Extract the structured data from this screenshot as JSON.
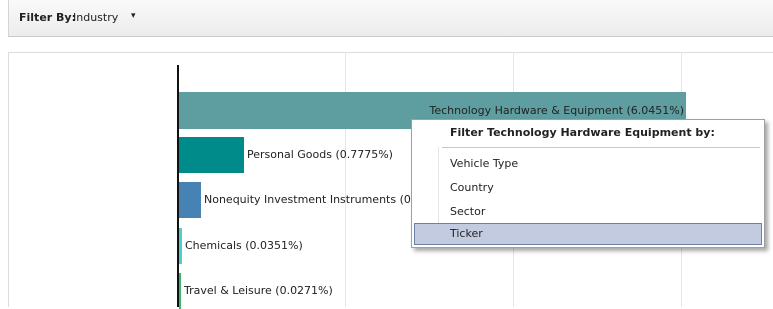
{
  "filter": {
    "label": "Filter By:",
    "value": "Industry",
    "caret": "▾"
  },
  "bars": [
    {
      "label": "Technology Hardware & Equipment (6.0451%)",
      "value": 6.0451,
      "color": "#5f9ea0"
    },
    {
      "label": "Personal Goods (0.7775%)",
      "value": 0.7775,
      "color": "#008b8b"
    },
    {
      "label": "Nonequity Investment Instruments (0",
      "value": 0.26,
      "color": "#4682b4"
    },
    {
      "label": "Chemicals (0.0351%)",
      "value": 0.0351,
      "color": "#48d1cc"
    },
    {
      "label": "Travel & Leisure (0.0271%)",
      "value": 0.0271,
      "color": "#3cb371"
    }
  ],
  "context_menu": {
    "title": "Filter Technology Hardware  Equipment by:",
    "items": [
      {
        "label": "Vehicle Type",
        "selected": false
      },
      {
        "label": "Country",
        "selected": false
      },
      {
        "label": "Sector",
        "selected": false
      },
      {
        "label": "Ticker",
        "selected": true
      }
    ]
  },
  "colors": {
    "selected_item_bg": "#c3cbe0",
    "axis": "#111111"
  }
}
